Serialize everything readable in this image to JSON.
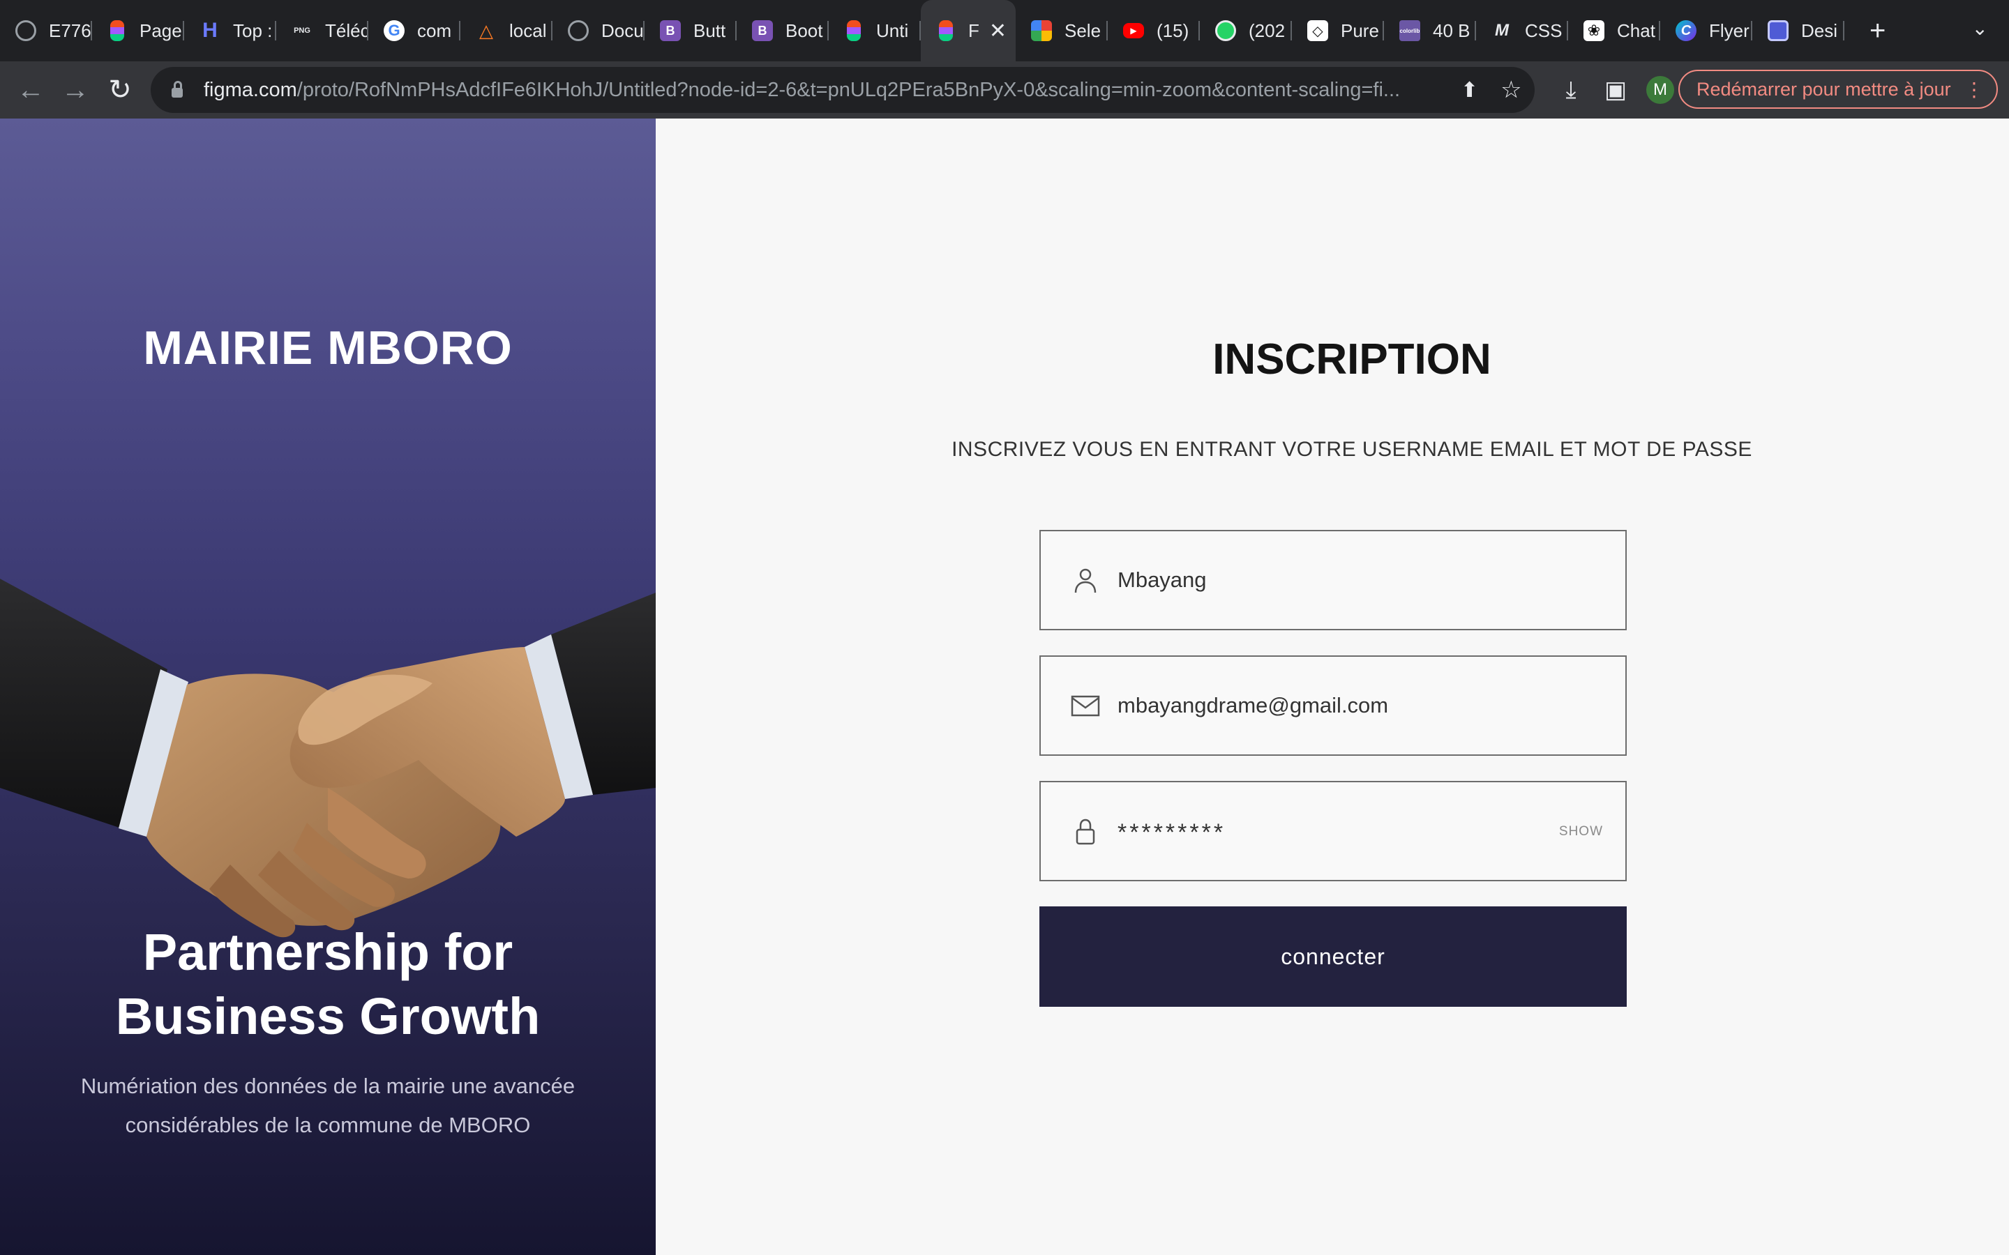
{
  "browser": {
    "tabs": [
      {
        "title": "E776",
        "icon": "globe-icon",
        "color": "#5f6368"
      },
      {
        "title": "Page",
        "icon": "figma-icon",
        "color": "#f24e1e"
      },
      {
        "title": "Top :",
        "icon": "h-logo-icon",
        "color": "#5b6cff"
      },
      {
        "title": "Téléc",
        "icon": "png-icon",
        "color": "#3c4043"
      },
      {
        "title": "com",
        "icon": "google-icon",
        "color": "#4285f4"
      },
      {
        "title": "local",
        "icon": "xampp-icon",
        "color": "#fb7a24"
      },
      {
        "title": "Docu",
        "icon": "globe-icon",
        "color": "#5f6368"
      },
      {
        "title": "Butt",
        "icon": "bootstrap-icon",
        "color": "#7952b3"
      },
      {
        "title": "Boot",
        "icon": "bootstrap-icon",
        "color": "#7952b3"
      },
      {
        "title": "Unti",
        "icon": "figma-icon",
        "color": "#f24e1e"
      },
      {
        "title": "F",
        "icon": "figma-icon",
        "color": "#f24e1e",
        "active": true
      },
      {
        "title": "Sele",
        "icon": "multicolor-icon",
        "color": "#34a853"
      },
      {
        "title": "(15)",
        "icon": "youtube-icon",
        "color": "#ff0000"
      },
      {
        "title": "(202",
        "icon": "whatsapp-icon",
        "color": "#25d366"
      },
      {
        "title": "Pure",
        "icon": "codepen-icon",
        "color": "#111111"
      },
      {
        "title": "40 B",
        "icon": "colorlib-icon",
        "color": "#6b57a5"
      },
      {
        "title": "CSS",
        "icon": "medium-icon",
        "color": "#202124"
      },
      {
        "title": "Chat",
        "icon": "openai-icon",
        "color": "#111111"
      },
      {
        "title": "Flyer",
        "icon": "canva-icon",
        "color": "#00c4cc"
      },
      {
        "title": "Desi",
        "icon": "browser-icon",
        "color": "#4f5bd5"
      }
    ],
    "url_host": "figma.com",
    "url_path": "/proto/RofNmPHsAdcfIFe6IKHohJ/Untitled?node-id=2-6&t=pnULq2PEra5BnPyX-0&scaling=min-zoom&content-scaling=fi...",
    "profile_initial": "M",
    "update_label": "Redémarrer pour mettre à jour"
  },
  "left_panel": {
    "brand": "MAIRIE MBORO",
    "headline_line1": "Partnership for",
    "headline_line2": "Business Growth",
    "subline_line1": "Numériation des données de la mairie une avancée",
    "subline_line2": "considérables de la commune de MBORO"
  },
  "form": {
    "title": "INSCRIPTION",
    "subtitle": "INSCRIVEZ VOUS EN ENTRANT VOTRE USERNAME  EMAIL ET MOT DE PASSE",
    "username": "Mbayang",
    "email": "mbayangdrame@gmail.com",
    "password": "*********",
    "show_label": "SHOW",
    "submit_label": "connecter"
  }
}
